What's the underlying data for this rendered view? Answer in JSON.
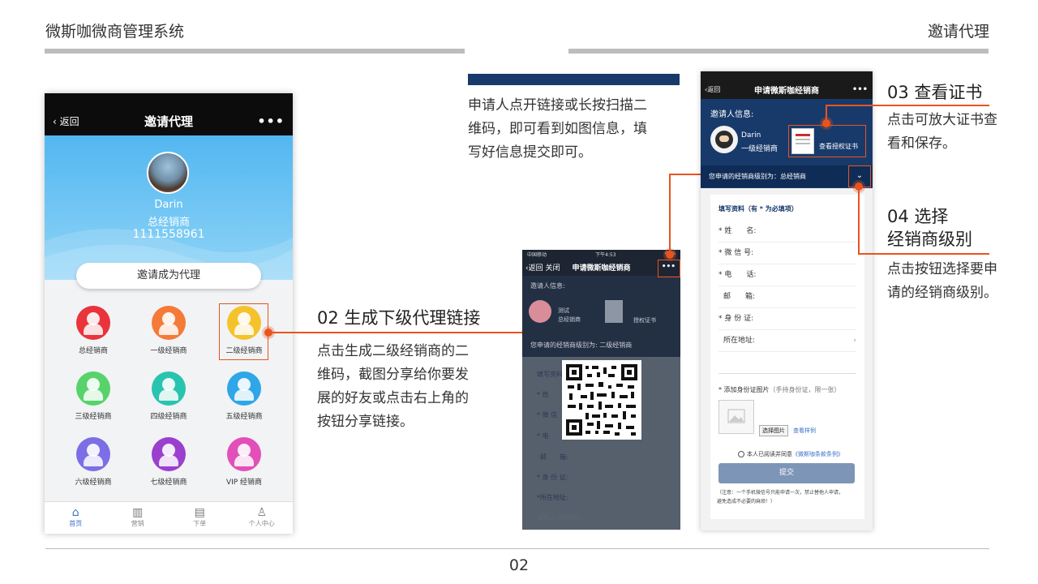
{
  "header": {
    "left_title": "微斯咖微商管理系统",
    "right_title": "邀请代理"
  },
  "footer": {
    "page_number": "02"
  },
  "phone1": {
    "nav": {
      "back": "返回",
      "title": "邀请代理",
      "more": "•••"
    },
    "profile": {
      "name": "Darin",
      "role": "总经销商",
      "phone": "1111558961"
    },
    "invite_button": "邀请成为代理",
    "levels": [
      {
        "label": "总经销商",
        "color": "#e8343a"
      },
      {
        "label": "一级经销商",
        "color": "#f47a3a"
      },
      {
        "label": "二级经销商",
        "color": "#f6c22c"
      },
      {
        "label": "三级经销商",
        "color": "#58d36a"
      },
      {
        "label": "四级经销商",
        "color": "#29c4b0"
      },
      {
        "label": "五级经销商",
        "color": "#2ea6e8"
      },
      {
        "label": "六级经销商",
        "color": "#7b6ee6"
      },
      {
        "label": "七级经销商",
        "color": "#9b3fcf"
      },
      {
        "label": "VIP 经销商",
        "color": "#e24fb8"
      }
    ],
    "tabs": [
      {
        "label": "首页",
        "icon": "home-icon"
      },
      {
        "label": "营销",
        "icon": "chart-icon"
      },
      {
        "label": "下单",
        "icon": "clipboard-icon"
      },
      {
        "label": "个人中心",
        "icon": "user-icon"
      }
    ]
  },
  "annot02": {
    "title": "02 生成下级代理链接",
    "text": [
      "点击生成二级经销商的二",
      "维码，截图分享给你要发",
      "展的好友或点击右上角的",
      "按钮分享链接。"
    ]
  },
  "annot_mid": {
    "text": [
      "申请人点开链接或长按扫描二",
      "维码，即可看到如图信息，填",
      "写好信息提交即可。"
    ]
  },
  "annot03": {
    "title": "03 查看证书",
    "text": [
      "点击可放大证书查",
      "看和保存。"
    ]
  },
  "annot04": {
    "title_line1": "04 选择",
    "title_line2": "经销商级别",
    "text": [
      "点击按钮选择要申",
      "请的经销商级别。"
    ]
  },
  "phone2": {
    "status": {
      "carrier": "中国移动",
      "time": "下午4:53",
      "battery": "47%"
    },
    "nav": {
      "back": "返回",
      "close": "关闭",
      "title": "申请微斯咖经销商",
      "more": "•••"
    },
    "inviter_label": "邀请人信息:",
    "inviter_name": "测试",
    "inviter_role": "总经销商",
    "cert_label": "授权证书",
    "level_label": "您申请的经销商级别为:",
    "level_value": "二级经销商",
    "form_title": "填写资料",
    "rows": [
      "* 姓",
      "* 微 信",
      "* 电",
      "邮　　箱:",
      "* 身 份 证:",
      "*所在地址:"
    ],
    "address_placeholder": "请输入详细地址"
  },
  "phone3": {
    "nav": {
      "back": "返回",
      "title": "申请微斯咖经销商",
      "more": "•••"
    },
    "inviter_label": "邀请人信息:",
    "inviter_name": "Darin",
    "inviter_role": "一级经销商",
    "cert_label": "查看授权证书",
    "level_label": "您申请的经销商级别为：总经销商",
    "form_title": "填写资料（有 * 为必填项）",
    "rows": [
      "* 姓　　名:",
      "* 微 信 号:",
      "* 电　　话:",
      "邮　　箱:",
      "* 身 份 证:",
      "所在地址:"
    ],
    "id_photo_label": "* 添加身份证图片",
    "id_photo_hint": "（手持身份证，限一张）",
    "choose_button": "选择图片",
    "example_link": "查看样例",
    "agree_text": "本人已阅读并同意",
    "agree_link": "《微斯咖条款条例》",
    "submit": "提交",
    "note": [
      "（注意：一个手机微信号只能申请一次，禁止替他人申请，",
      "避免造成不必要的麻烦！）"
    ]
  }
}
